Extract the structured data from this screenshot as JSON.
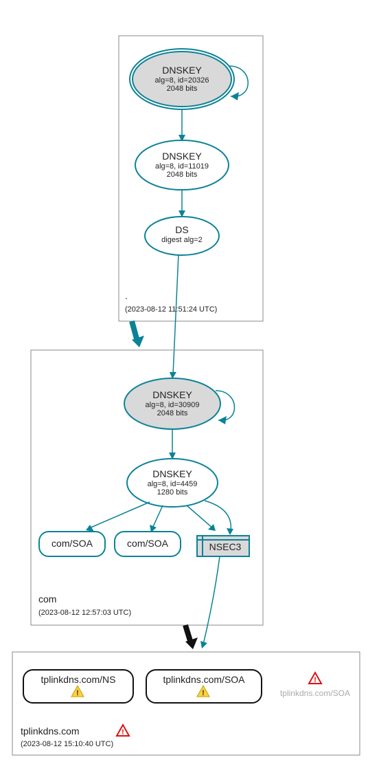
{
  "zones": {
    "root": {
      "label": ".",
      "time": "(2023-08-12 11:51:24 UTC)",
      "nodes": {
        "dnskey1": {
          "title": "DNSKEY",
          "sub1": "alg=8, id=20326",
          "sub2": "2048 bits"
        },
        "dnskey2": {
          "title": "DNSKEY",
          "sub1": "alg=8, id=11019",
          "sub2": "2048 bits"
        },
        "ds": {
          "title": "DS",
          "sub1": "digest alg=2"
        }
      }
    },
    "com": {
      "label": "com",
      "time": "(2023-08-12 12:57:03 UTC)",
      "nodes": {
        "dnskey1": {
          "title": "DNSKEY",
          "sub1": "alg=8, id=30909",
          "sub2": "2048 bits"
        },
        "dnskey2": {
          "title": "DNSKEY",
          "sub1": "alg=8, id=4459",
          "sub2": "1280 bits"
        },
        "soa1": {
          "title": "com/SOA"
        },
        "soa2": {
          "title": "com/SOA"
        },
        "nsec3": {
          "title": "NSEC3"
        }
      }
    },
    "tplinkdns": {
      "label": "tplinkdns.com",
      "time": "(2023-08-12 15:10:40 UTC)",
      "nodes": {
        "ns": {
          "title": "tplinkdns.com/NS"
        },
        "soa": {
          "title": "tplinkdns.com/SOA"
        },
        "ghost": {
          "title": "tplinkdns.com/SOA"
        }
      }
    }
  }
}
